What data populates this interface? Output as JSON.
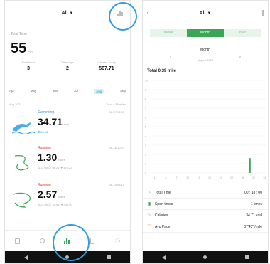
{
  "left": {
    "filter": "All",
    "total_time_label": "Total Time",
    "total_time_value": "55",
    "total_time_unit": "min",
    "stats": [
      {
        "label": "Total times",
        "value": "3"
      },
      {
        "label": "Total days",
        "value": "2"
      },
      {
        "label": "Calories (kcal)",
        "value": "567.71"
      }
    ],
    "months": [
      "Apr",
      "May",
      "Jun",
      "Jul",
      "Aug",
      "Sep"
    ],
    "selected_month": "Aug",
    "period_left": "Aug 2021",
    "period_right": "Total 4.58 miles",
    "records": [
      {
        "type": "Swimming",
        "time": "08-27 10:05",
        "distance": "34.71",
        "unit": "kcal",
        "meta": "⏱ 24:15",
        "type_color": "#2e9ee0"
      },
      {
        "type": "Running",
        "time": "08-16 10:07",
        "distance": "1.30",
        "unit": "miles",
        "meta": "⏱ 11:00  ⟳ 08'24\" ♥ 170.22",
        "type_color": "#e5473a"
      },
      {
        "type": "Running",
        "time": "08-16 08:15",
        "distance": "2.57",
        "unit": "miles",
        "meta": "⏱ 21:00  ⟳ 08'51\" ♥ 333.60",
        "type_color": "#e5473a"
      }
    ],
    "tabs": [
      "home",
      "sport",
      "records",
      "device",
      "settings"
    ]
  },
  "right": {
    "filter": "All",
    "segments": [
      "Week",
      "Month",
      "Year"
    ],
    "active_segment": "Month",
    "month_title": "Month",
    "month_sub": "August 2021",
    "total_label": "Total",
    "total_value": "0.39 mile",
    "y_ticks": [
      "10",
      "9",
      "8",
      "7",
      "6",
      "5",
      "4",
      "3",
      "2",
      "1",
      "0"
    ],
    "x_ticks": [
      "1",
      "4",
      "7",
      "10",
      "13",
      "16",
      "19",
      "22",
      "25",
      "28",
      "31"
    ],
    "summary": [
      {
        "icon": "clock-icon",
        "label": "Total Time",
        "value": "00 : 18 : 00",
        "color": "#999999"
      },
      {
        "icon": "bar-chart-icon",
        "label": "Sport times",
        "value": "1 times",
        "color": "#3aa757"
      },
      {
        "icon": "flame-icon",
        "label": "Calories",
        "value": "34.71 kcal",
        "color": "#e5473a"
      },
      {
        "icon": "pace-icon",
        "label": "Avg Pace",
        "value": "07'43\" /mile",
        "color": "#f0a020"
      }
    ]
  },
  "chart_data": {
    "type": "bar",
    "categories": [
      "1",
      "2",
      "3",
      "4",
      "5",
      "6",
      "7",
      "8",
      "9",
      "10",
      "11",
      "12",
      "13",
      "14",
      "15",
      "16",
      "17",
      "18",
      "19",
      "20",
      "21",
      "22",
      "23",
      "24",
      "25",
      "26",
      "27",
      "28",
      "29",
      "30",
      "31"
    ],
    "values": [
      0,
      0,
      0,
      0,
      0,
      0,
      0,
      0,
      0,
      0,
      0,
      0,
      0,
      0,
      0,
      0,
      0,
      0,
      0,
      0,
      0,
      0,
      0,
      0,
      0,
      0,
      1.6,
      0,
      0,
      0,
      0
    ],
    "ylim": [
      0,
      10
    ],
    "color": "#3aa757"
  }
}
